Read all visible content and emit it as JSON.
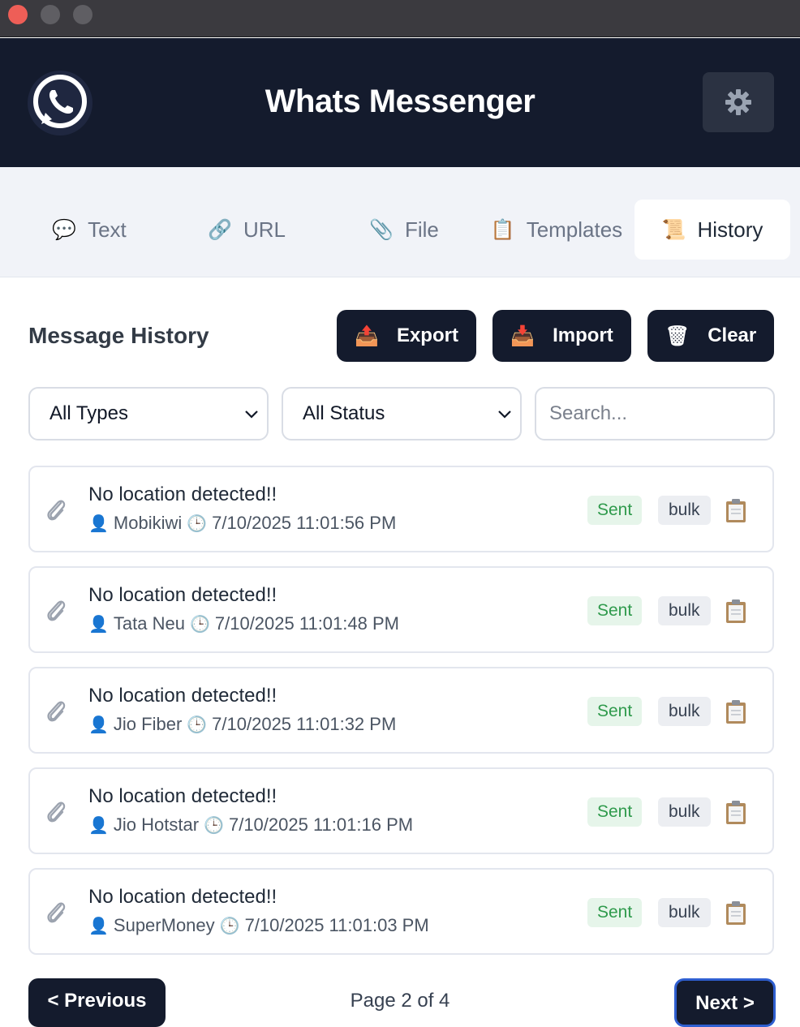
{
  "app": {
    "title": "Whats Messenger"
  },
  "icons": {
    "tab_text": "💬",
    "tab_url": "🔗",
    "tab_file": "📎",
    "tab_templates": "📋",
    "tab_history": "📜",
    "export": "📤",
    "import": "📥",
    "clear": "🗑",
    "user": "👤",
    "clock": "🕒"
  },
  "tabs": [
    {
      "label": "Text"
    },
    {
      "label": "URL"
    },
    {
      "label": "File"
    },
    {
      "label": "Templates"
    },
    {
      "label": "History",
      "active": true
    }
  ],
  "history": {
    "title": "Message History",
    "export_label": "Export",
    "import_label": "Import",
    "clear_label": "Clear",
    "type_filter": "All Types",
    "status_filter": "All Status",
    "search_placeholder": "Search...",
    "items": [
      {
        "message": "No location detected!!",
        "contact": "Mobikiwi",
        "timestamp": "7/10/2025 11:01:56 PM",
        "status": "Sent",
        "type": "bulk"
      },
      {
        "message": "No location detected!!",
        "contact": "Tata Neu",
        "timestamp": "7/10/2025 11:01:48 PM",
        "status": "Sent",
        "type": "bulk"
      },
      {
        "message": "No location detected!!",
        "contact": "Jio Fiber",
        "timestamp": "7/10/2025 11:01:32 PM",
        "status": "Sent",
        "type": "bulk"
      },
      {
        "message": "No location detected!!",
        "contact": "Jio Hotstar",
        "timestamp": "7/10/2025 11:01:16 PM",
        "status": "Sent",
        "type": "bulk"
      },
      {
        "message": "No location detected!!",
        "contact": "SuperMoney",
        "timestamp": "7/10/2025 11:01:03 PM",
        "status": "Sent",
        "type": "bulk"
      }
    ]
  },
  "pagination": {
    "prev_label": "< Previous",
    "next_label": "Next >",
    "page_text": "Page 2 of 4"
  },
  "colors": {
    "header_bg": "#141b2d",
    "accent_green": "#2f9a4c",
    "next_border": "#2f5fd0"
  }
}
